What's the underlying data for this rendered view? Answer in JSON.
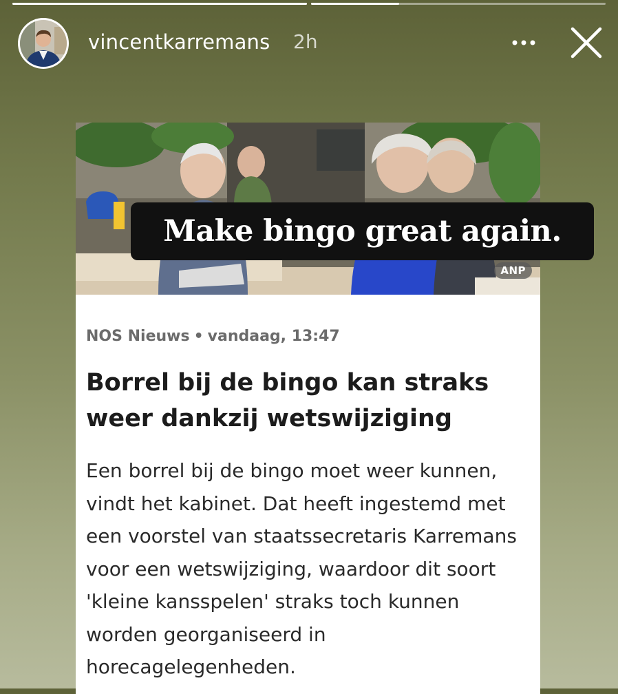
{
  "story": {
    "username": "vincentkarremans",
    "time": "2h",
    "progress": [
      1.0,
      0.3
    ]
  },
  "icons": {
    "more": "more-dots-icon",
    "close": "close-icon"
  },
  "card": {
    "photo_credit": "ANP",
    "source": "NOS Nieuws",
    "separator": "•",
    "timestamp": "vandaag, 13:47",
    "headline": "Borrel bij de bingo kan straks weer dankzij wetswijziging",
    "body": "Een borrel bij de bingo moet weer kunnen, vindt het kabinet. Dat heeft ingestemd met een voorstel van staatssecretaris Karremans voor een wetswijziging, waardoor dit soort 'kleine kansspelen' straks toch kunnen worden georganiseerd in horecagelegenheden."
  },
  "sticker": {
    "text": "Make bingo great again."
  }
}
